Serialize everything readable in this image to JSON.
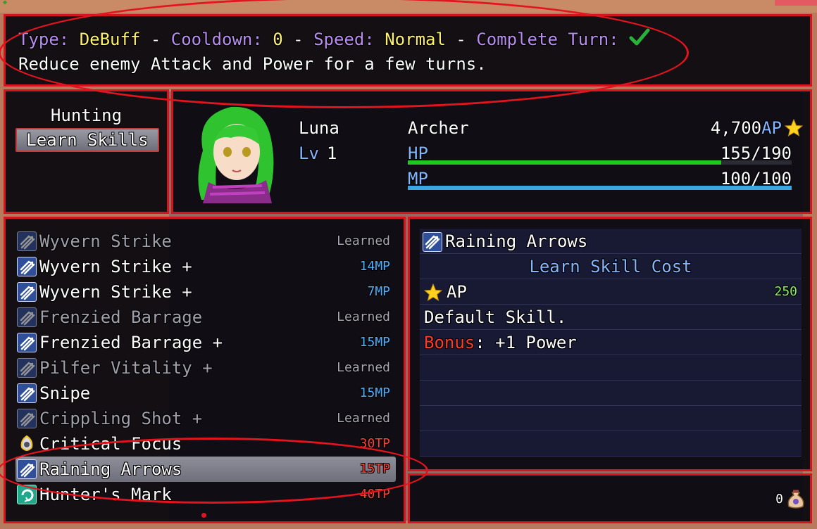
{
  "help": {
    "type_label": "Type:",
    "type_value": "DeBuff",
    "cooldown_label": "Cooldown:",
    "cooldown_value": "0",
    "speed_label": "Speed:",
    "speed_value": "Normal",
    "complete_label": "Complete Turn:",
    "sep": "-",
    "description": "Reduce enemy Attack and Power for a few turns."
  },
  "command": {
    "stype": "Hunting",
    "action": "Learn Skills"
  },
  "actor": {
    "name": "Luna",
    "lv_label": "Lv",
    "lv_value": "1",
    "class": "Archer",
    "ap_value": "4,700",
    "ap_label": "AP",
    "hp_label": "HP",
    "hp_value": "155/190",
    "hp_ratio": 0.816,
    "mp_label": "MP",
    "mp_value": "100/100",
    "mp_ratio": 1.0,
    "colors": {
      "hp": "#1ec81e",
      "mp": "#3aa6e0"
    }
  },
  "skills": [
    {
      "name": "Wyvern Strike",
      "cost": "Learned",
      "learned": true,
      "icon": "arrows-icon"
    },
    {
      "name": "Wyvern Strike +",
      "cost": "14MP",
      "learned": false,
      "icon": "arrows-icon"
    },
    {
      "name": "Wyvern Strike +",
      "cost": "7MP",
      "learned": false,
      "icon": "arrows-icon"
    },
    {
      "name": "Frenzied Barrage",
      "cost": "Learned",
      "learned": true,
      "icon": "arrows-icon"
    },
    {
      "name": "Frenzied Barrage +",
      "cost": "15MP",
      "learned": false,
      "icon": "arrows-icon"
    },
    {
      "name": "Pilfer Vitality +",
      "cost": "Learned",
      "learned": true,
      "icon": "arrows-icon"
    },
    {
      "name": "Snipe",
      "cost": "15MP",
      "learned": false,
      "icon": "arrows-icon"
    },
    {
      "name": "Crippling Shot +",
      "cost": "Learned",
      "learned": true,
      "icon": "arrows-icon"
    },
    {
      "name": "Critical Focus",
      "cost": "30TP",
      "learned": false,
      "icon": "focus-icon"
    },
    {
      "name": "Raining Arrows",
      "cost": "15TP",
      "learned": false,
      "icon": "arrows-icon",
      "selected": true
    },
    {
      "name": "Hunter's Mark",
      "cost": "40TP",
      "learned": false,
      "icon": "mark-icon"
    }
  ],
  "detail": {
    "skill_name": "Raining Arrows",
    "cost_header": "Learn Skill Cost",
    "ap_label": "AP",
    "ap_cost": "250",
    "default_text": "Default Skill.",
    "bonus_label": "Bonus",
    "bonus_value": ": +1 Power"
  },
  "gold": {
    "value": "0",
    "icon": "money-bag-icon"
  }
}
